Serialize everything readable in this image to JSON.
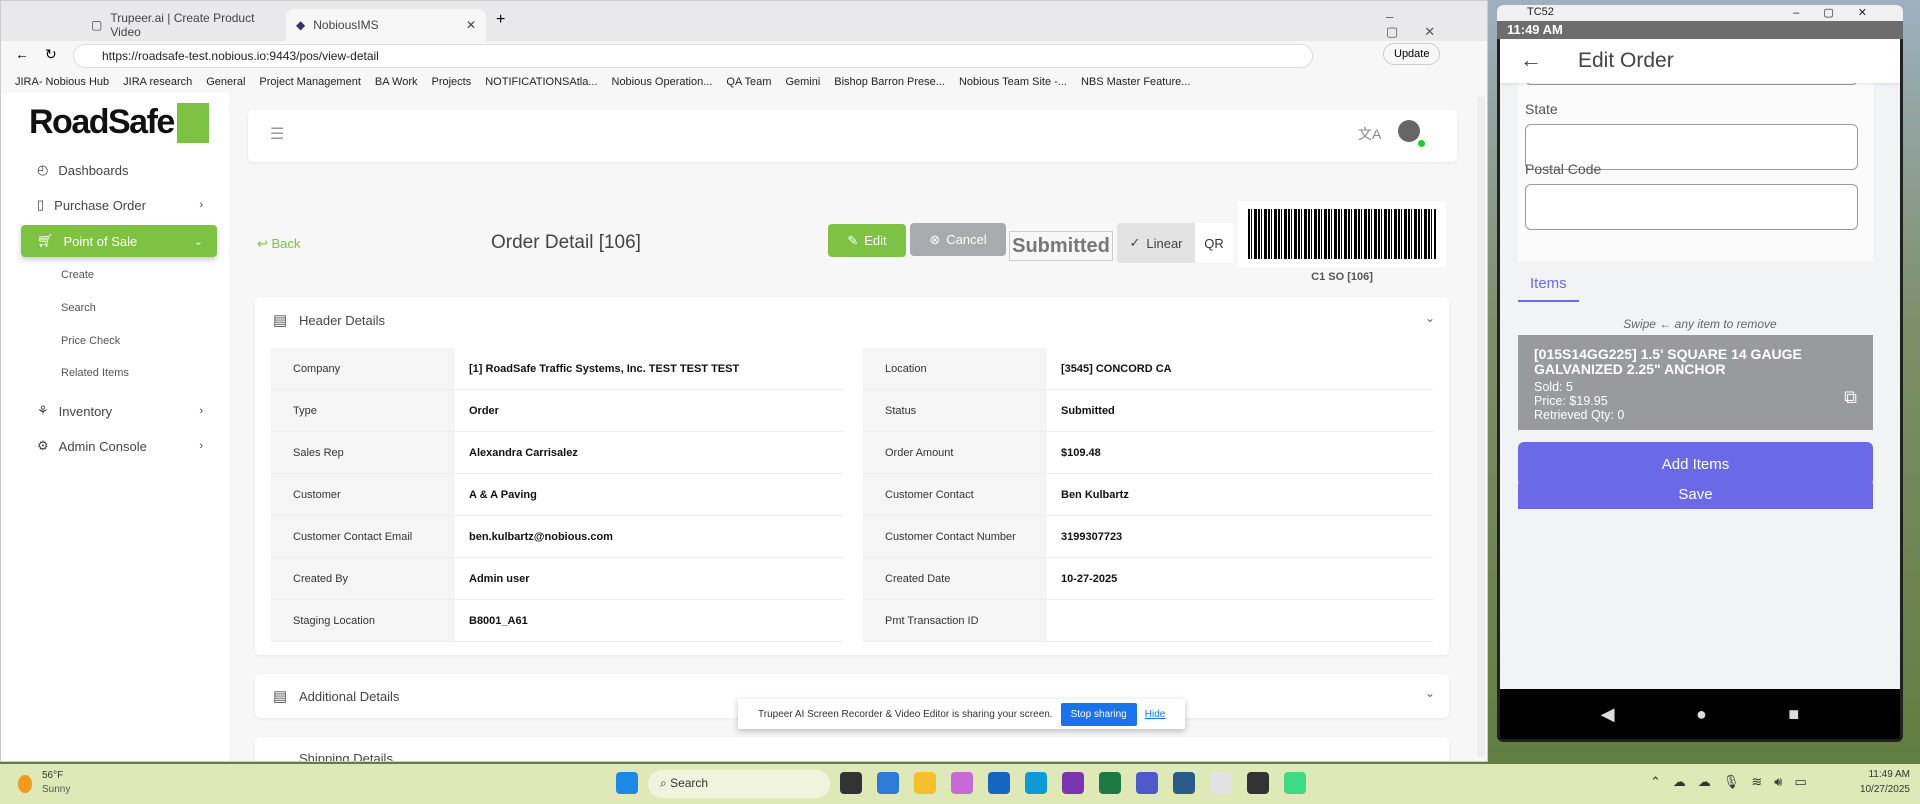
{
  "browser": {
    "tabs": [
      {
        "label": "Trupeer.ai | Create Product Video"
      },
      {
        "label": "NobiousIMS"
      }
    ],
    "url": "https://roadsafe-test.nobious.io:9443/pos/view-detail",
    "update_label": "Update",
    "bookmarks": [
      "JIRA- Nobious Hub",
      "JIRA research",
      "General",
      "Project Management",
      "BA Work",
      "Projects",
      "NOTIFICATIONSAtla...",
      "Nobious Operation...",
      "QA Team",
      "Gemini",
      "Bishop Barron Prese...",
      "Nobious Team Site -...",
      "NBS Master Feature..."
    ]
  },
  "app": {
    "logo": "RoadSafe",
    "sidebar": {
      "items": [
        {
          "label": "Dashboards"
        },
        {
          "label": "Purchase Order"
        },
        {
          "label": "Point of Sale"
        },
        {
          "label": "Inventory"
        },
        {
          "label": "Admin Console"
        }
      ],
      "sub_items": [
        "Create",
        "Search",
        "Price Check",
        "Related Items"
      ]
    },
    "page": {
      "back": "Back",
      "title": "Order Detail [106]",
      "edit": "Edit",
      "cancel": "Cancel",
      "status": "Submitted",
      "linear": "Linear",
      "qr": "QR",
      "barcode_label": "C1 SO [106]"
    },
    "header_details": {
      "title": "Header Details",
      "left": [
        [
          "Company",
          "[1] RoadSafe Traffic Systems, Inc. TEST TEST TEST"
        ],
        [
          "Type",
          "Order"
        ],
        [
          "Sales Rep",
          "Alexandra Carrisalez"
        ],
        [
          "Customer",
          "A & A Paving"
        ],
        [
          "Customer Contact Email",
          "ben.kulbartz@nobious.com"
        ],
        [
          "Created By",
          "Admin user"
        ],
        [
          "Staging Location",
          "B8001_A61"
        ]
      ],
      "right": [
        [
          "Location",
          "[3545] CONCORD CA"
        ],
        [
          "Status",
          "Submitted"
        ],
        [
          "Order Amount",
          "$109.48"
        ],
        [
          "Customer Contact",
          "Ben Kulbartz"
        ],
        [
          "Customer Contact Number",
          "3199307723"
        ],
        [
          "Created Date",
          "10-27-2025"
        ],
        [
          "Pmt Transaction ID",
          ""
        ]
      ]
    },
    "additional_details": "Additional Details",
    "shipping_details": "Shipping Details"
  },
  "share_banner": {
    "text": "Trupeer AI Screen Recorder & Video Editor is sharing your screen.",
    "stop": "Stop sharing",
    "hide": "Hide"
  },
  "phone": {
    "window_title": "TC52",
    "time": "11:49 AM",
    "title": "Edit Order",
    "state_label": "State",
    "postal_label": "Postal Code",
    "items_tab": "Items",
    "swipe_hint": "Swipe ← any item to remove",
    "item": {
      "name": "[015S14GG225] 1.5' SQUARE 14 GAUGE GALVANIZED 2.25\" ANCHOR",
      "sold": "Sold: 5",
      "price": "Price: $19.95",
      "retrieved": "Retrieved Qty: 0"
    },
    "add_items": "Add Items",
    "save": "Save"
  },
  "taskbar": {
    "weather_temp": "56°F",
    "weather_desc": "Sunny",
    "search": "Search",
    "time": "11:49 AM",
    "date": "10/27/2025"
  }
}
